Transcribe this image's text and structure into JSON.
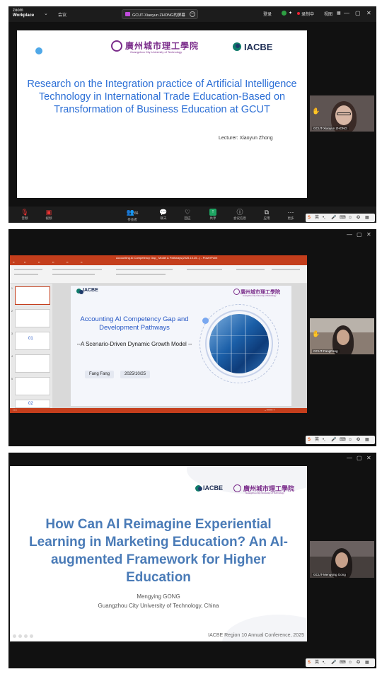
{
  "panel1": {
    "app_name_top": "zoom",
    "app_name_bottom": "Workplace",
    "meeting_label": "会议",
    "share_title": "GCUT-Xiaoyun ZHONG的屏幕",
    "top_right": {
      "login": "登录",
      "recording": "录制中",
      "view": "视图"
    },
    "slide": {
      "university_cn": "廣州城市理工學院",
      "university_en": "Guangzhou City University of Technology",
      "accreditor": "IACBE",
      "title": "Research on the Integration practice of Artificial Intelligence Technology in International Trade Education-Based on Transformation of Business Education at GCUT",
      "lecturer": "Lecturer: Xiaoyun Zhong"
    },
    "participant_name": "GCUT-Xiaoyun ZHONG",
    "toolbar": [
      {
        "icon": "mic-muted-icon",
        "label": "音频",
        "style": "red"
      },
      {
        "icon": "video-off-icon",
        "label": "视频",
        "style": "red"
      },
      {
        "icon": "participants-icon",
        "label": "参会者",
        "style": ""
      },
      {
        "icon": "chat-icon",
        "label": "聊天",
        "style": ""
      },
      {
        "icon": "react-icon",
        "label": "回应",
        "style": ""
      },
      {
        "icon": "share-icon",
        "label": "共享",
        "style": "green"
      },
      {
        "icon": "info-icon",
        "label": "会议信息",
        "style": ""
      },
      {
        "icon": "apps-icon",
        "label": "应用",
        "style": ""
      },
      {
        "icon": "more-icon",
        "label": "更多",
        "style": ""
      }
    ],
    "participant_count": "66",
    "ime_label": "英"
  },
  "panel2": {
    "window_title": "Accounting AI Competency Gap_ Model & Pathways(2025.10.25...) - PowerPoint",
    "slide": {
      "accreditor": "IACBE",
      "university_cn": "廣州城市理工學院",
      "university_en": "Guangzhou City University of Technology",
      "title": "Accounting AI Competency Gap and Development Pathways",
      "subtitle": "--A Scenario-Driven Dynamic Growth Model --",
      "presenter": "Fang Fang",
      "date": "2025/10/25"
    },
    "thumb_labels": [
      "01",
      "02"
    ],
    "participant_name": "GCUT-FangFang",
    "ime_label": "英"
  },
  "panel3": {
    "slide": {
      "accreditor": "IACBE",
      "university_cn": "廣州城市理工學院",
      "university_en": "Guangzhou City University of Technology",
      "title": "How Can AI Reimagine Experiential Learning in Marketing Education? An AI-augmented Framework for Higher Education",
      "presenter": "Mengying GONG",
      "institution": "Guangzhou City University of Technology, China",
      "conference": "IACBE Region 10 Annual Conference, 2025"
    },
    "participant_name": "GCUT-Mengying Gong",
    "ime_label": "英"
  },
  "colors": {
    "gcut_purple": "#7b2d8b",
    "title_blue": "#2c6fd6",
    "ppt_orange": "#c43e1c",
    "zoom_share_green": "#1ea362",
    "muted_red": "#e33333"
  }
}
